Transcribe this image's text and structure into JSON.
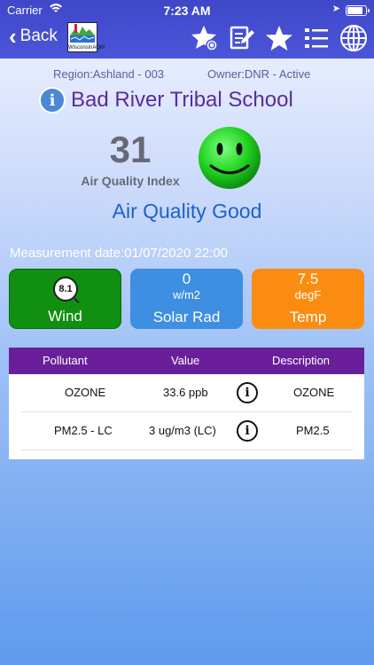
{
  "status_bar": {
    "carrier": "Carrier",
    "time": "7:23 AM"
  },
  "nav": {
    "back_label": "Back",
    "logo_text": "WisconsinAQM"
  },
  "station": {
    "region": "Region:Ashland - 003",
    "owner": "Owner:DNR - Active",
    "name": "Bad River Tribal School"
  },
  "aqi": {
    "value": "31",
    "label": "Air Quality Index",
    "description": "Air Quality Good",
    "face_color": "#1fcf1f"
  },
  "measurement_date": "Measurement date:01/07/2020 22:00",
  "tiles": [
    {
      "value": "8.1",
      "label": "Wind",
      "color": "#108f10"
    },
    {
      "value": "0",
      "unit": "w/m2",
      "label": "Solar Rad",
      "color": "#3e8fe2"
    },
    {
      "value": "7.5",
      "unit": "degF",
      "label": "Temp",
      "color": "#fb8c12"
    }
  ],
  "table": {
    "headers": {
      "pollutant": "Pollutant",
      "value": "Value",
      "description": "Description"
    },
    "rows": [
      {
        "pollutant": "OZONE",
        "value": "33.6 ppb",
        "description": "OZONE"
      },
      {
        "pollutant": "PM2.5 - LC",
        "value": "3 ug/m3 (LC)",
        "description": "PM2.5"
      }
    ],
    "header_color": "#6a1f9a"
  },
  "icons": [
    "star-sync-icon",
    "edit-note-icon",
    "star-icon",
    "list-icon",
    "globe-icon"
  ]
}
